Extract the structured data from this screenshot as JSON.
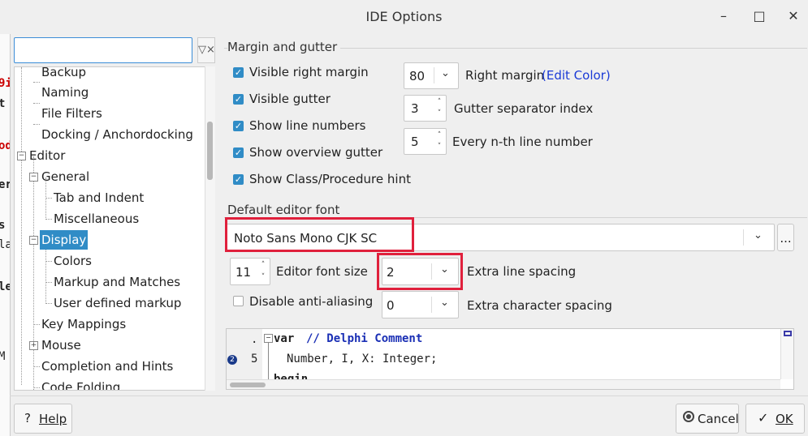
{
  "window": {
    "title": "IDE Options",
    "minimize_icon": "minimize-icon",
    "maximize_icon": "maximize-icon",
    "close_icon": "close-icon"
  },
  "background_window": {
    "fragments": [
      "9i",
      "t",
      "od",
      "er",
      "s",
      "la",
      "le",
      "M"
    ]
  },
  "search": {
    "value": "",
    "placeholder": ""
  },
  "tree": {
    "items": [
      {
        "label": "Backup",
        "level": 2
      },
      {
        "label": "Naming",
        "level": 2
      },
      {
        "label": "File Filters",
        "level": 2
      },
      {
        "label": "Docking / Anchordocking",
        "level": 2
      },
      {
        "label": "Editor",
        "level": 1,
        "expander": "−"
      },
      {
        "label": "General",
        "level": 2,
        "expander": "−"
      },
      {
        "label": "Tab and Indent",
        "level": 3
      },
      {
        "label": "Miscellaneous",
        "level": 3
      },
      {
        "label": "Display",
        "level": 2,
        "expander": "−",
        "selected": true
      },
      {
        "label": "Colors",
        "level": 3
      },
      {
        "label": "Markup and Matches",
        "level": 3
      },
      {
        "label": "User defined markup",
        "level": 3
      },
      {
        "label": "Key Mappings",
        "level": 2
      },
      {
        "label": "Mouse",
        "level": 2,
        "expander": "+"
      },
      {
        "label": "Completion and Hints",
        "level": 2
      },
      {
        "label": "Code Folding",
        "level": 2
      }
    ]
  },
  "margin_gutter": {
    "title": "Margin and gutter",
    "checkboxes": [
      {
        "label": "Visible right margin",
        "checked": true
      },
      {
        "label": "Visible gutter",
        "checked": true
      },
      {
        "label": "Show line numbers",
        "checked": true
      },
      {
        "label": "Show overview gutter",
        "checked": true
      },
      {
        "label": "Show Class/Procedure hint",
        "checked": true
      }
    ],
    "right_margin": {
      "value": "80",
      "label": "Right margin",
      "link": "(Edit Color)"
    },
    "gutter_separator": {
      "value": "3",
      "label": "Gutter separator index"
    },
    "nth_line": {
      "value": "5",
      "label": "Every n-th line number"
    }
  },
  "font": {
    "title": "Default editor font",
    "font_name": "Noto Sans Mono CJK SC",
    "browse_label": "...",
    "font_size": {
      "value": "11",
      "label": "Editor font size"
    },
    "line_spacing": {
      "value": "2",
      "label": "Extra line spacing"
    },
    "anti_aliasing": {
      "label": "Disable anti-aliasing",
      "checked": false
    },
    "char_spacing": {
      "value": "0",
      "label": "Extra character spacing"
    }
  },
  "preview": {
    "lines": [
      {
        "gutter": ".",
        "marker": "",
        "keyword": "var",
        "comment": "// Delphi Comment"
      },
      {
        "gutter": "5",
        "marker": "2",
        "code": "Number, I, X: Integer;"
      },
      {
        "gutter": "",
        "marker": "",
        "keyword": "begin"
      }
    ]
  },
  "buttons": {
    "help": "Help",
    "cancel": "Cancel",
    "ok": "OK"
  },
  "colors": {
    "accent": "#308cc6",
    "highlight_box": "#e0203c",
    "link": "#1a3ad6",
    "keyword": "#000000",
    "comment": "#1a2fb5"
  }
}
